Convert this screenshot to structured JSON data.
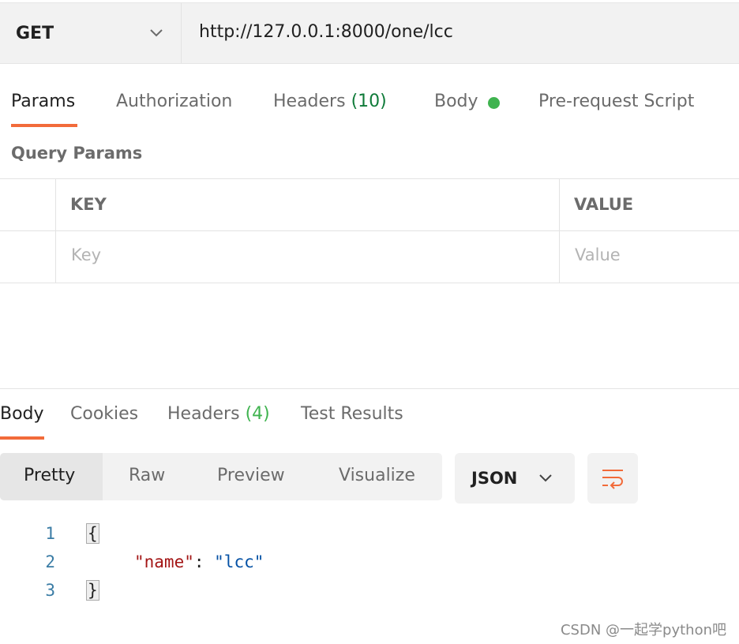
{
  "request": {
    "method": "GET",
    "url": "http://127.0.0.1:8000/one/lcc"
  },
  "request_tabs": [
    {
      "label": "Params",
      "active": true
    },
    {
      "label": "Authorization"
    },
    {
      "label": "Headers",
      "count": "(10)"
    },
    {
      "label": "Body",
      "indicator": "green-dot"
    },
    {
      "label": "Pre-request Script"
    }
  ],
  "query_params": {
    "title": "Query Params",
    "columns": [
      "KEY",
      "VALUE"
    ],
    "placeholders": {
      "key": "Key",
      "value": "Value"
    }
  },
  "response_tabs": [
    {
      "label": "Body",
      "active": true
    },
    {
      "label": "Cookies"
    },
    {
      "label": "Headers",
      "count": "(4)"
    },
    {
      "label": "Test Results"
    }
  ],
  "view_modes": [
    {
      "label": "Pretty",
      "active": true
    },
    {
      "label": "Raw"
    },
    {
      "label": "Preview"
    },
    {
      "label": "Visualize"
    }
  ],
  "format": "JSON",
  "code": {
    "line_numbers": [
      "1",
      "2",
      "3"
    ],
    "open_brace": "{",
    "key": "\"name\"",
    "colon": ": ",
    "value": "\"lcc\"",
    "close_brace": "}"
  },
  "watermark": "CSDN @一起学python吧",
  "colors": {
    "accent": "#f26b3a",
    "green": "#3fb34f",
    "code_key": "#a31515",
    "code_string": "#0451a5"
  }
}
